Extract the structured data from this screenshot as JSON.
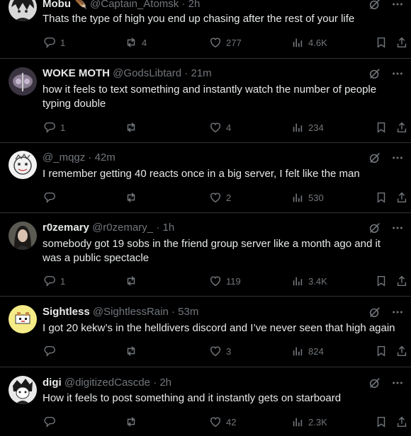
{
  "tweets": [
    {
      "name": "Mobu",
      "handle": "@Captain_Atomsk",
      "sep": "·",
      "time": "2h",
      "text": "Thats the type of high you end up chasing after the rest of your life",
      "replies": "1",
      "retweets": "4",
      "likes": "277",
      "views": "4.6K",
      "avatar_icon": "anime-character-avatar"
    },
    {
      "name": "WOKE MOTH",
      "handle": "@GodsLibtard",
      "sep": "·",
      "time": "21m",
      "text": "how it feels to text something and instantly watch the number of people typing double",
      "replies": "1",
      "retweets": "",
      "likes": "4",
      "views": "234",
      "avatar_icon": "moth-avatar"
    },
    {
      "name": "",
      "handle": "@_mqgz",
      "sep": "·",
      "time": "42m",
      "text": "I remember getting 40 reacts once in a big server, I felt like the man",
      "replies": "",
      "retweets": "",
      "likes": "2",
      "views": "530",
      "avatar_icon": "doodle-face-avatar"
    },
    {
      "name": "r0zemary",
      "handle": "@r0zemary_",
      "sep": "·",
      "time": "1h",
      "text": "somebody got 19 sobs in the friend group server like a month ago and it was a public spectacle",
      "replies": "1",
      "retweets": "",
      "likes": "119",
      "views": "3.4K",
      "avatar_icon": "person-photo-avatar"
    },
    {
      "name": "Sightless",
      "handle": "@SightlessRain",
      "sep": "·",
      "time": "53m",
      "text": "I got 20 kekw’s in the helldivers discord and I’ve never seen that high again",
      "replies": "",
      "retweets": "",
      "likes": "3",
      "views": "824",
      "avatar_icon": "pixel-dog-avatar"
    },
    {
      "name": "digi",
      "handle": "@digitizedCascde",
      "sep": "·",
      "time": "2h",
      "text": "How it feels to post something and it instantly gets on starboard",
      "replies": "",
      "retweets": "",
      "likes": "42",
      "views": "2.3K",
      "avatar_icon": "sketch-character-avatar"
    }
  ],
  "colors": {
    "background": "#000000",
    "text": "#e7e9ea",
    "muted": "#71767b",
    "divider": "#2f3336"
  }
}
